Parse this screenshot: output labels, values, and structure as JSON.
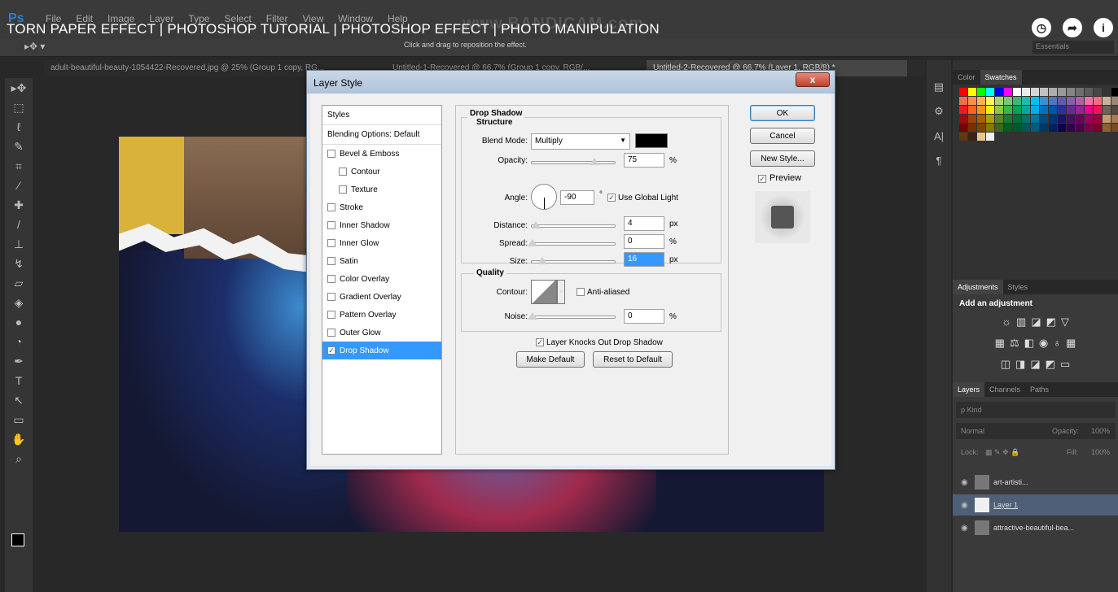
{
  "app": {
    "menu": [
      "File",
      "Edit",
      "Image",
      "Layer",
      "Type",
      "Select",
      "Filter",
      "View",
      "Window",
      "Help"
    ],
    "video_title": "TORN PAPER EFFECT | PHOTOSHOP TUTORIAL | PHOTOSHOP EFFECT | PHOTO MANIPULATION",
    "watermark": "www.BANDICAM.com",
    "hint": "Click and drag to reposition the effect.",
    "essentials": "Essentials"
  },
  "tabs": [
    "adult-beautiful-beauty-1054422-Recovered.jpg @ 25% (Group 1 copy, RG...",
    "Untitled-1-Recovered @ 66.7% (Group 1 copy, RGB/...",
    "Untitled-2-Recovered @ 66.7% (Layer 1, RGB/8) *"
  ],
  "dialog": {
    "title": "Layer Style",
    "close": "x",
    "styles_header": "Styles",
    "blending": "Blending Options: Default",
    "items": [
      {
        "label": "Bevel & Emboss",
        "checked": false
      },
      {
        "label": "Contour",
        "checked": false,
        "indent": true
      },
      {
        "label": "Texture",
        "checked": false,
        "indent": true
      },
      {
        "label": "Stroke",
        "checked": false
      },
      {
        "label": "Inner Shadow",
        "checked": false
      },
      {
        "label": "Inner Glow",
        "checked": false
      },
      {
        "label": "Satin",
        "checked": false
      },
      {
        "label": "Color Overlay",
        "checked": false
      },
      {
        "label": "Gradient Overlay",
        "checked": false
      },
      {
        "label": "Pattern Overlay",
        "checked": false
      },
      {
        "label": "Outer Glow",
        "checked": false
      },
      {
        "label": "Drop Shadow",
        "checked": true,
        "selected": true
      }
    ],
    "section": "Drop Shadow",
    "structure": "Structure",
    "blend_mode_label": "Blend Mode:",
    "blend_mode": "Multiply",
    "shadow_color": "#000000",
    "opacity_label": "Opacity:",
    "opacity": "75",
    "opacity_fraction": 0.75,
    "angle_label": "Angle:",
    "angle": "-90",
    "degree": "°",
    "use_global_light": "Use Global Light",
    "distance_label": "Distance:",
    "distance": "4",
    "spread_label": "Spread:",
    "spread": "0",
    "size_label": "Size:",
    "size": "16",
    "pct": "%",
    "px": "px",
    "quality": "Quality",
    "contour_label": "Contour:",
    "anti_aliased": "Anti-aliased",
    "noise_label": "Noise:",
    "noise": "0",
    "knockout": "Layer Knocks Out Drop Shadow",
    "make_default": "Make Default",
    "reset_default": "Reset to Default",
    "ok": "OK",
    "cancel": "Cancel",
    "new_style": "New Style...",
    "preview": "Preview"
  },
  "panels": {
    "color_tab": "Color",
    "swatches_tab": "Swatches",
    "adjustments_tab": "Adjustments",
    "styles_tab": "Styles",
    "add_adjustment": "Add an adjustment",
    "layers_tab": "Layers",
    "channels_tab": "Channels",
    "paths_tab": "Paths",
    "kind": "ρ Kind",
    "blend": "Normal",
    "opacity_label": "Opacity:",
    "opacity": "100%",
    "lock_label": "Lock:",
    "fill_label": "Fill:",
    "fill": "100%",
    "layers": [
      {
        "name": "art-artisti...",
        "active": false
      },
      {
        "name": "Layer 1",
        "active": true
      },
      {
        "name": "attractive-beautiful-bea...",
        "active": false
      }
    ]
  },
  "colors": {
    "accent": "#3399ff",
    "swatches": [
      "#ff0000",
      "#ffff00",
      "#00ff00",
      "#00ffff",
      "#0000ff",
      "#ff00ff",
      "#ffffff",
      "#ebebeb",
      "#d6d6d6",
      "#c2c2c2",
      "#adadad",
      "#999999",
      "#858585",
      "#707070",
      "#5c5c5c",
      "#474747",
      "#333333",
      "#000000",
      "#f26c4f",
      "#f68e56",
      "#fbaf5d",
      "#fff467",
      "#acd372",
      "#7cc576",
      "#3bb878",
      "#1abbb4",
      "#00bff3",
      "#438ccb",
      "#5574b9",
      "#605ca8",
      "#855fa8",
      "#a763a8",
      "#f06ea9",
      "#f26d7d",
      "#c7b299",
      "#998675",
      "#ed1c24",
      "#f26522",
      "#f7941d",
      "#fff200",
      "#8dc73f",
      "#39b54a",
      "#00a651",
      "#00a99d",
      "#00aeef",
      "#0072bc",
      "#0054a6",
      "#2e3192",
      "#662d91",
      "#92278f",
      "#ec008c",
      "#ed145b",
      "#736357",
      "#534741",
      "#9e0b0f",
      "#a0410d",
      "#a36209",
      "#aba000",
      "#598527",
      "#1a7b30",
      "#007236",
      "#00746b",
      "#0076a3",
      "#004b80",
      "#003471",
      "#1b1464",
      "#440e62",
      "#630460",
      "#9e005d",
      "#9e0039",
      "#c69c6d",
      "#a67c52",
      "#790000",
      "#7b2e00",
      "#7d4900",
      "#827b00",
      "#406618",
      "#005e20",
      "#005826",
      "#005952",
      "#005b7f",
      "#003663",
      "#002157",
      "#0d004c",
      "#32004b",
      "#4b0049",
      "#7b0046",
      "#7a0026",
      "#8c6239",
      "#754c24",
      "#603913",
      "#3c2415",
      "#e6c88c",
      "#f0f0f0"
    ]
  }
}
